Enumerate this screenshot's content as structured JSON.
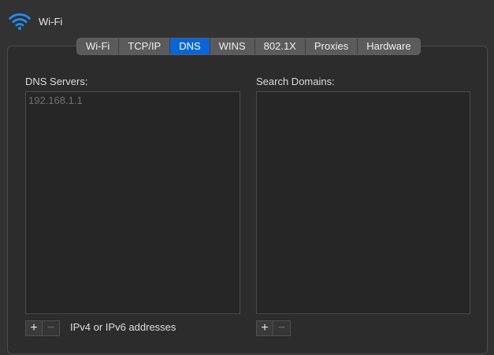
{
  "window": {
    "title": "Wi-Fi",
    "icon": "wifi-icon"
  },
  "tabs": [
    {
      "label": "Wi-Fi"
    },
    {
      "label": "TCP/IP"
    },
    {
      "label": "DNS"
    },
    {
      "label": "WINS"
    },
    {
      "label": "802.1X"
    },
    {
      "label": "Proxies"
    },
    {
      "label": "Hardware"
    }
  ],
  "active_tab": "DNS",
  "dns": {
    "label": "DNS Servers:",
    "servers": [
      "192.168.1.1"
    ],
    "add_label": "+",
    "remove_label": "−",
    "hint": "IPv4 or IPv6 addresses"
  },
  "search": {
    "label": "Search Domains:",
    "domains": [],
    "add_label": "+",
    "remove_label": "−"
  },
  "colors": {
    "accent": "#0a65d8",
    "background": "#323232",
    "list_bg": "#262626"
  }
}
